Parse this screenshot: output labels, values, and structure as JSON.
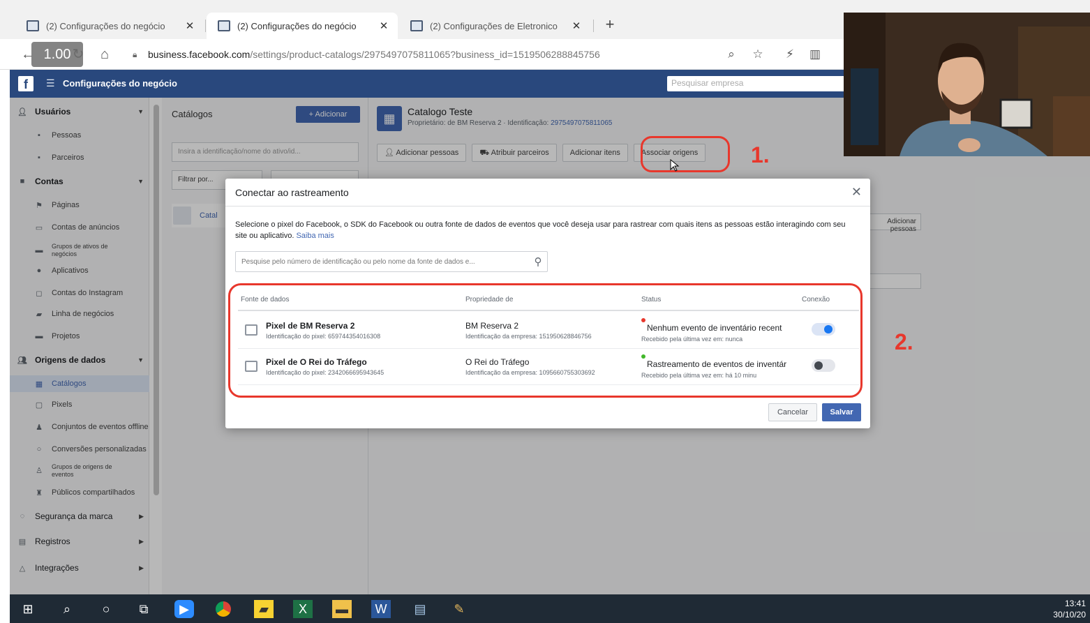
{
  "colors": {
    "fb_blue": "#4267b2",
    "fb_header": "#29487d",
    "annotation_red": "#e8372c",
    "toggle_on": "#1877f2"
  },
  "browser": {
    "tabs": [
      {
        "label": "(2) Configurações do negócio",
        "active": false
      },
      {
        "label": "(2) Configurações do negócio",
        "active": true
      },
      {
        "label": "(2) Configurações de Eletronico",
        "active": false
      }
    ],
    "newtab_icon": "plus-icon",
    "playback_speed": "1.00",
    "url_host": "business.facebook.com",
    "url_path": "/settings/product-catalogs/2975497075811065?business_id=1519506288845756"
  },
  "fb": {
    "header_title": "Configurações do negócio",
    "search_placeholder": "Pesquisar empresa"
  },
  "sidebar": {
    "sections": [
      {
        "label": "Usuários",
        "items": [
          "Pessoas",
          "Parceiros"
        ]
      },
      {
        "label": "Contas",
        "items": [
          "Páginas",
          "Contas de anúncios",
          "Grupos de ativos de negócios",
          "Aplicativos",
          "Contas do Instagram",
          "Linha de negócios",
          "Projetos"
        ]
      },
      {
        "label": "Origens de dados",
        "items": [
          "Catálogos",
          "Pixels",
          "Conjuntos de eventos offline",
          "Conversões personalizadas",
          "Grupos de origens de eventos",
          "Públicos compartilhados"
        ]
      },
      {
        "label": "Segurança da marca",
        "items": []
      },
      {
        "label": "Registros",
        "items": []
      },
      {
        "label": "Integrações",
        "items": []
      }
    ]
  },
  "catalog_panel": {
    "title": "Catálogos",
    "add_label": "+ Adicionar",
    "search_placeholder": "Insira a identificação/nome do ativo/id...",
    "filter_label": "Filtrar por...",
    "row_label": "Catal"
  },
  "main": {
    "catalog_title": "Catalogo Teste",
    "owner_text": "Proprietário: de BM Reserva 2 · Identificação:",
    "catalog_id": "2975497075811065",
    "actions": [
      "Adicionar pessoas",
      "Atribuir parceiros",
      "Adicionar itens",
      "Associar origens"
    ],
    "side_button": "Adicionar pessoas"
  },
  "modal": {
    "title": "Conectar ao rastreamento",
    "description": "Selecione o pixel do Facebook, o SDK do Facebook ou outra fonte de dados de eventos que você deseja usar para rastrear com quais itens as pessoas estão interagindo com seu site ou aplicativo.",
    "learn_more": "Saiba mais",
    "search_placeholder": "Pesquise pelo número de identificação ou pelo nome da fonte de dados e...",
    "columns": [
      "Fonte de dados",
      "Propriedade de",
      "Status",
      "Conexão"
    ],
    "rows": [
      {
        "name": "Pixel de BM Reserva 2",
        "id_text": "Identificação do pixel: 659744354016308",
        "owner": "BM Reserva 2",
        "owner_id_text": "Identificação da empresa: 151950628846756",
        "status_color": "#e8372c",
        "status": "Nenhum evento de inventário recent",
        "status_sub": "Recebido pela última vez em: nunca",
        "connected": true
      },
      {
        "name": "Pixel de O Rei do Tráfego",
        "id_text": "Identificação do pixel: 2342066695943645",
        "owner": "O Rei do Tráfego",
        "owner_id_text": "Identificação da empresa: 1095660755303692",
        "status_color": "#42b72a",
        "status": "Rastreamento de eventos de inventár",
        "status_sub": "Recebido pela última vez em: há 10 minu",
        "connected": false
      }
    ],
    "cancel_label": "Cancelar",
    "save_label": "Salvar"
  },
  "annotations": {
    "step1": "1.",
    "step2": "2."
  },
  "taskbar": {
    "icons": [
      "windows-start-icon",
      "search-icon",
      "cortana-icon",
      "task-view-icon",
      "zoom-app-icon",
      "chrome-icon",
      "sticky-notes-icon",
      "excel-icon",
      "file-explorer-icon",
      "word-icon",
      "notepad-icon",
      "paint-icon"
    ],
    "time": "13:41",
    "date": "30/10/20"
  }
}
